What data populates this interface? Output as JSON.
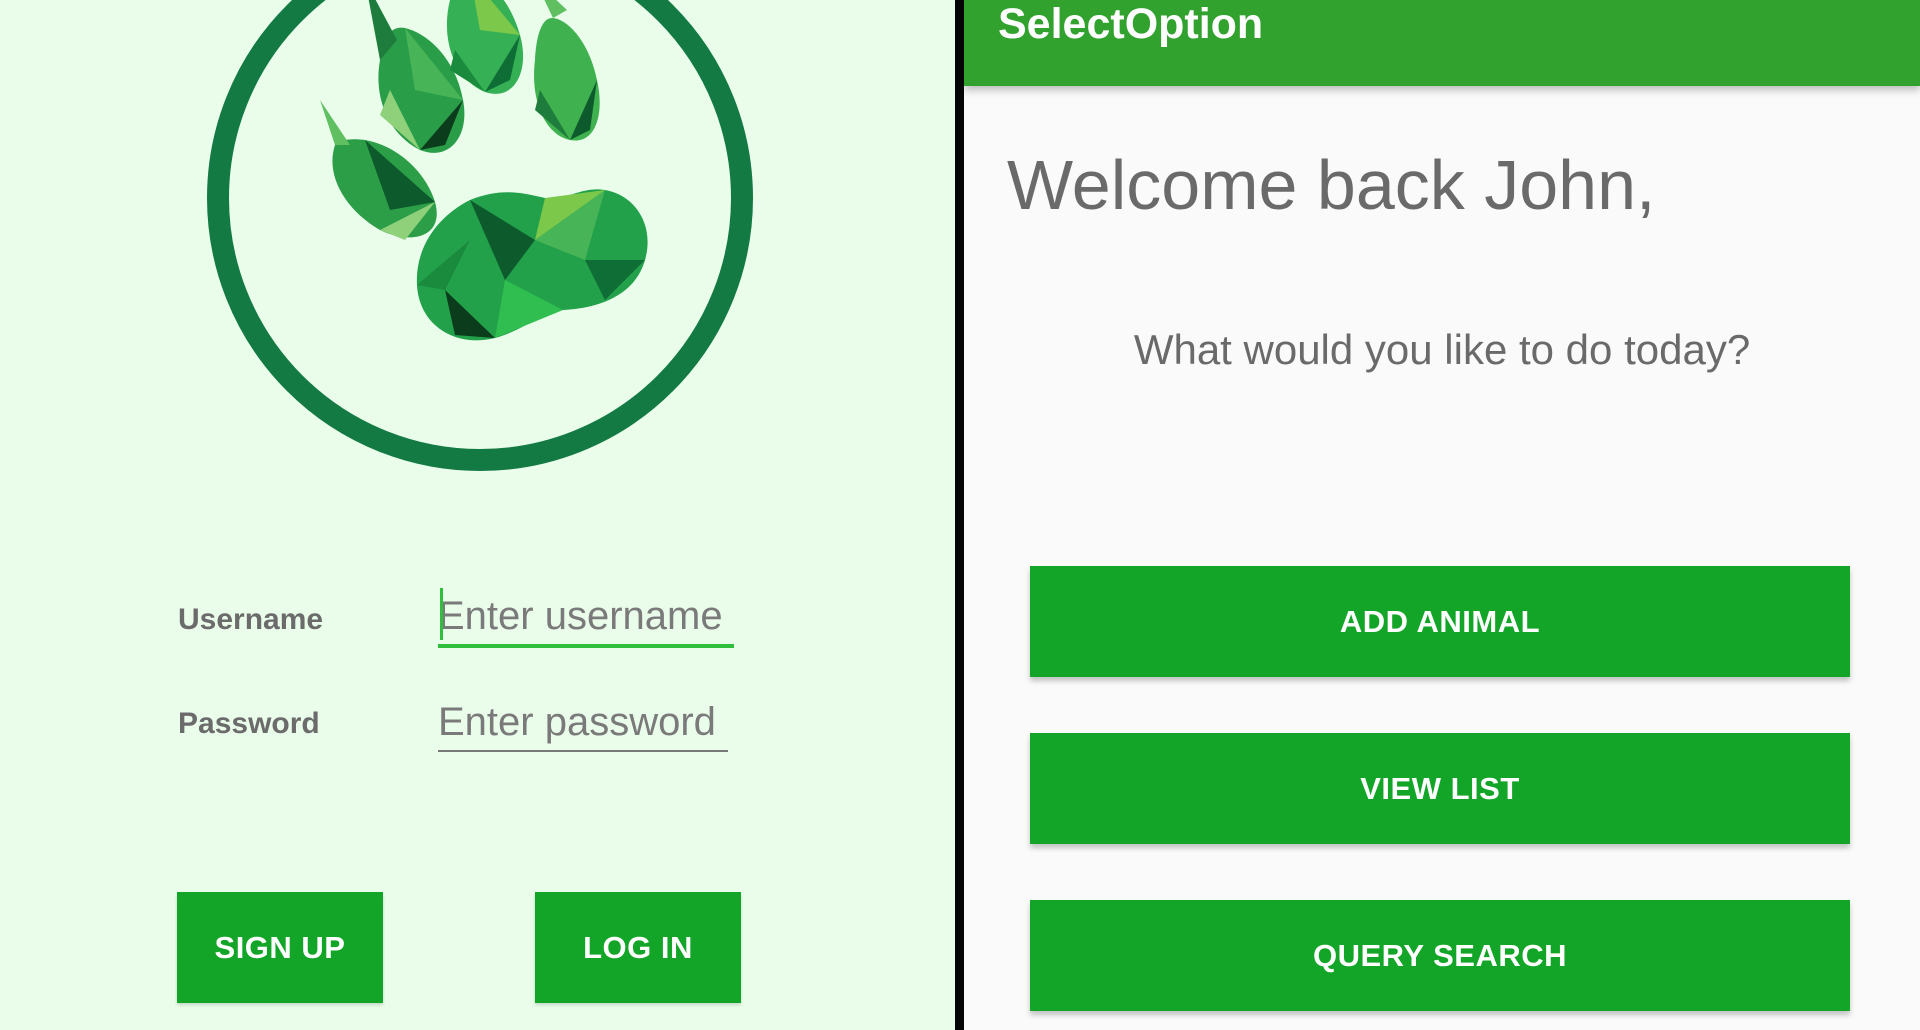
{
  "login": {
    "username_label": "Username",
    "username_placeholder": "Enter username",
    "password_label": "Password",
    "password_placeholder": "Enter password",
    "signup_label": "SIGN UP",
    "login_label": "LOG IN"
  },
  "select": {
    "app_title": "SelectOption",
    "welcome": "Welcome back John,",
    "prompt": "What would you like to do today?",
    "buttons": [
      {
        "label": "ADD ANIMAL"
      },
      {
        "label": "VIEW LIST"
      },
      {
        "label": "QUERY SEARCH"
      }
    ]
  },
  "icons": {
    "logo": "paw-print-logo"
  },
  "colors": {
    "login_background": "#e9fdea",
    "button_green": "#12a527",
    "app_bar_green": "#31a22e",
    "input_focus_green": "#2fbf3c",
    "logo_ring": "#137a43",
    "screen_background": "#fafafa"
  }
}
